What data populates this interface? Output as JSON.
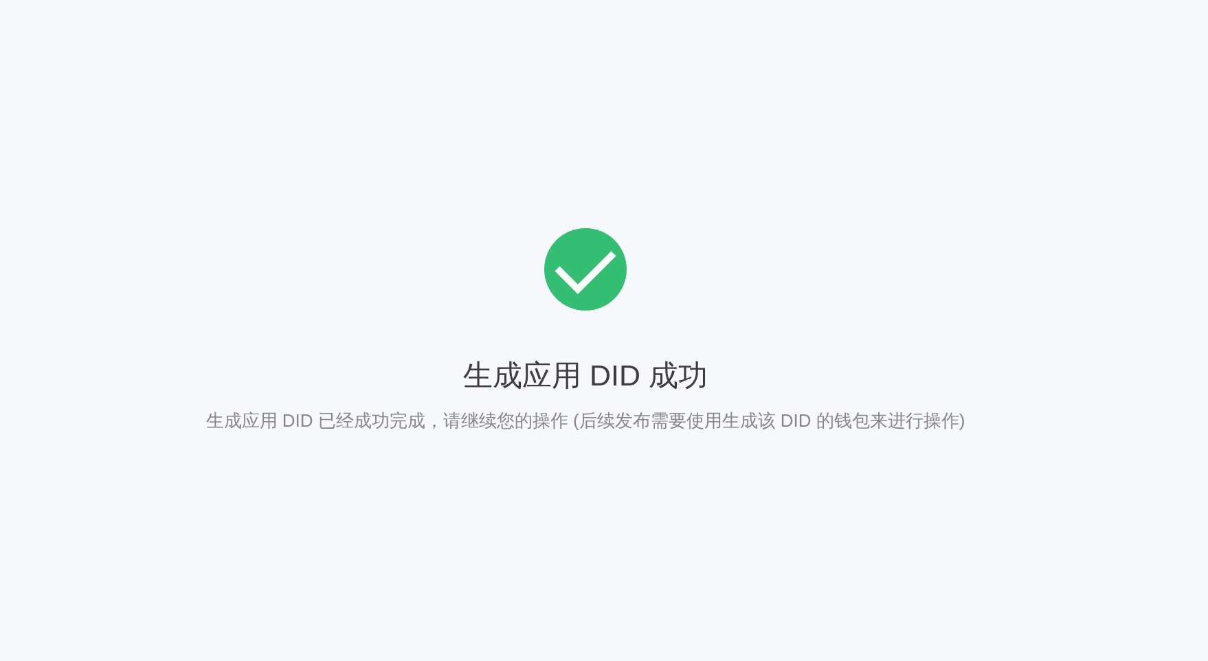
{
  "result": {
    "kind": "success",
    "title": "生成应用 DID 成功",
    "description": "生成应用 DID 已经成功完成，请继续您的操作 (后续发布需要使用生成该 DID 的钱包来进行操作)"
  }
}
